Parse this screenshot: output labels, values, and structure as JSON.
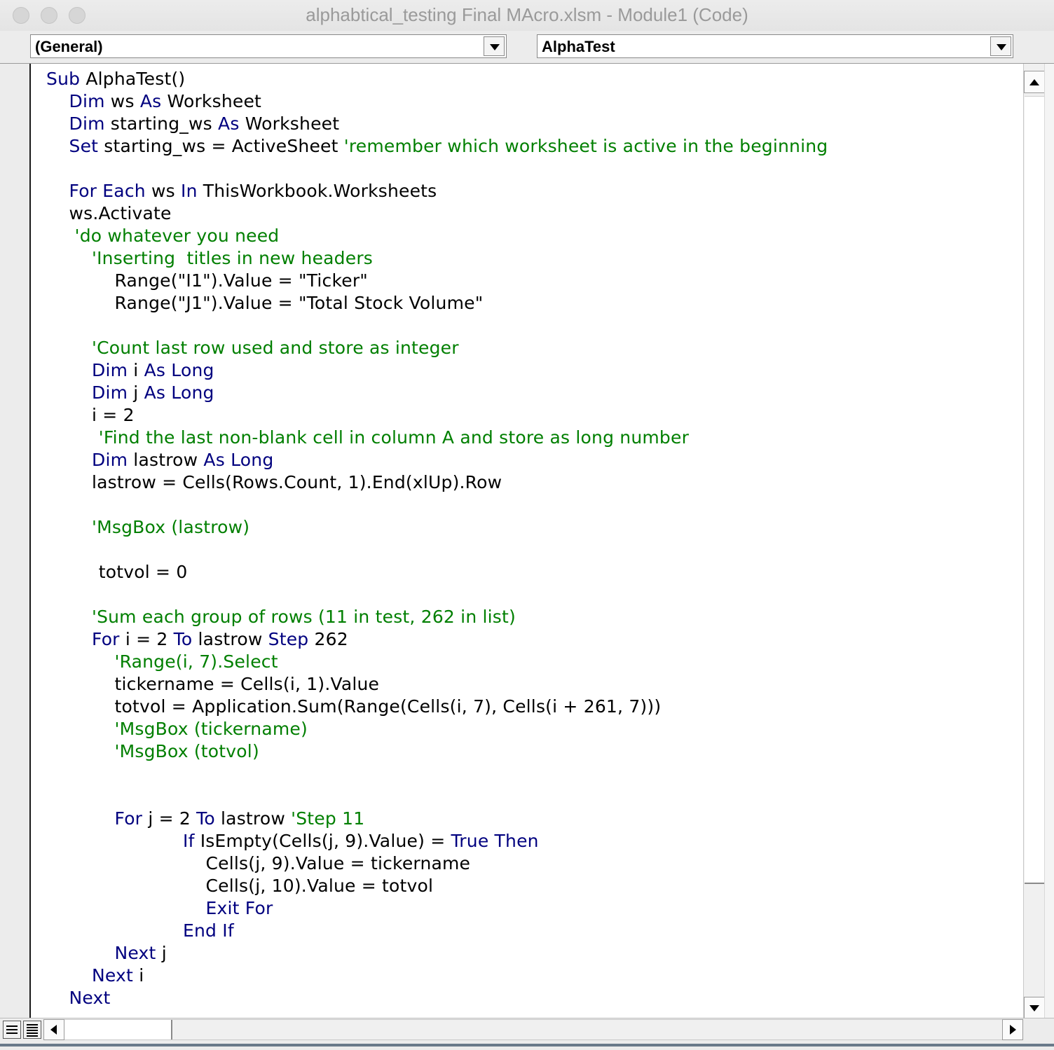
{
  "window": {
    "title": "alphabtical_testing Final MAcro.xlsm - Module1 (Code)"
  },
  "dropdowns": {
    "object": "(General)",
    "procedure": "AlphaTest"
  },
  "code_lines": [
    {
      "indent": 0,
      "tokens": [
        {
          "t": "Sub",
          "c": "kw"
        },
        {
          "t": " AlphaTest()",
          "c": ""
        }
      ]
    },
    {
      "indent": 1,
      "tokens": [
        {
          "t": "Dim",
          "c": "kw"
        },
        {
          "t": " ws ",
          "c": ""
        },
        {
          "t": "As",
          "c": "kw"
        },
        {
          "t": " Worksheet",
          "c": ""
        }
      ]
    },
    {
      "indent": 1,
      "tokens": [
        {
          "t": "Dim",
          "c": "kw"
        },
        {
          "t": " starting_ws ",
          "c": ""
        },
        {
          "t": "As",
          "c": "kw"
        },
        {
          "t": " Worksheet",
          "c": ""
        }
      ]
    },
    {
      "indent": 1,
      "tokens": [
        {
          "t": "Set",
          "c": "kw"
        },
        {
          "t": " starting_ws = ActiveSheet ",
          "c": ""
        },
        {
          "t": "'remember which worksheet is active in the beginning",
          "c": "cm"
        }
      ]
    },
    {
      "indent": 1,
      "tokens": []
    },
    {
      "indent": 1,
      "tokens": [
        {
          "t": "For Each",
          "c": "kw"
        },
        {
          "t": " ws ",
          "c": ""
        },
        {
          "t": "In",
          "c": "kw"
        },
        {
          "t": " ThisWorkbook.Worksheets",
          "c": ""
        }
      ]
    },
    {
      "indent": 1,
      "tokens": [
        {
          "t": "ws.Activate",
          "c": ""
        }
      ]
    },
    {
      "indent": 1.25,
      "tokens": [
        {
          "t": "'do whatever you need",
          "c": "cm"
        }
      ]
    },
    {
      "indent": 2,
      "tokens": [
        {
          "t": "'Inserting  titles in new headers",
          "c": "cm"
        }
      ]
    },
    {
      "indent": 3,
      "tokens": [
        {
          "t": "Range(\"I1\").Value = \"Ticker\"",
          "c": ""
        }
      ]
    },
    {
      "indent": 3,
      "tokens": [
        {
          "t": "Range(\"J1\").Value = \"Total Stock Volume\"",
          "c": ""
        }
      ]
    },
    {
      "indent": 2,
      "tokens": []
    },
    {
      "indent": 2,
      "tokens": [
        {
          "t": "'Count last row used and store as integer",
          "c": "cm"
        }
      ]
    },
    {
      "indent": 2,
      "tokens": [
        {
          "t": "Dim",
          "c": "kw"
        },
        {
          "t": " i ",
          "c": ""
        },
        {
          "t": "As Long",
          "c": "kw"
        }
      ]
    },
    {
      "indent": 2,
      "tokens": [
        {
          "t": "Dim",
          "c": "kw"
        },
        {
          "t": " j ",
          "c": ""
        },
        {
          "t": "As Long",
          "c": "kw"
        }
      ]
    },
    {
      "indent": 2,
      "tokens": [
        {
          "t": "i = 2",
          "c": ""
        }
      ]
    },
    {
      "indent": 2.3,
      "tokens": [
        {
          "t": "'Find the last non-blank cell in column A and store as long number",
          "c": "cm"
        }
      ]
    },
    {
      "indent": 2,
      "tokens": [
        {
          "t": "Dim",
          "c": "kw"
        },
        {
          "t": " lastrow ",
          "c": ""
        },
        {
          "t": "As Long",
          "c": "kw"
        }
      ]
    },
    {
      "indent": 2,
      "tokens": [
        {
          "t": "lastrow = Cells(Rows.Count, 1).End(xlUp).Row",
          "c": ""
        }
      ]
    },
    {
      "indent": 2,
      "tokens": []
    },
    {
      "indent": 2,
      "tokens": [
        {
          "t": "'MsgBox (lastrow)",
          "c": "cm"
        }
      ]
    },
    {
      "indent": 2,
      "tokens": []
    },
    {
      "indent": 2.3,
      "tokens": [
        {
          "t": "totvol = 0",
          "c": ""
        }
      ]
    },
    {
      "indent": 2,
      "tokens": []
    },
    {
      "indent": 2,
      "tokens": [
        {
          "t": "'Sum each group of rows (11 in test, 262 in list)",
          "c": "cm"
        }
      ]
    },
    {
      "indent": 2,
      "tokens": [
        {
          "t": "For",
          "c": "kw"
        },
        {
          "t": " i = 2 ",
          "c": ""
        },
        {
          "t": "To",
          "c": "kw"
        },
        {
          "t": " lastrow ",
          "c": ""
        },
        {
          "t": "Step",
          "c": "kw"
        },
        {
          "t": " 262",
          "c": ""
        }
      ]
    },
    {
      "indent": 3,
      "tokens": [
        {
          "t": "'Range(i, 7).Select",
          "c": "cm"
        }
      ]
    },
    {
      "indent": 3,
      "tokens": [
        {
          "t": "tickername = Cells(i, 1).Value",
          "c": ""
        }
      ]
    },
    {
      "indent": 3,
      "tokens": [
        {
          "t": "totvol = Application.Sum(Range(Cells(i, 7), Cells(i + 261, 7)))",
          "c": ""
        }
      ]
    },
    {
      "indent": 3,
      "tokens": [
        {
          "t": "'MsgBox (tickername)",
          "c": "cm"
        }
      ]
    },
    {
      "indent": 3,
      "tokens": [
        {
          "t": "'MsgBox (totvol)",
          "c": "cm"
        }
      ]
    },
    {
      "indent": 3,
      "tokens": []
    },
    {
      "indent": 3,
      "tokens": []
    },
    {
      "indent": 3,
      "tokens": [
        {
          "t": "For",
          "c": "kw"
        },
        {
          "t": " j = 2 ",
          "c": ""
        },
        {
          "t": "To",
          "c": "kw"
        },
        {
          "t": " lastrow ",
          "c": ""
        },
        {
          "t": "'Step 11",
          "c": "cm"
        }
      ]
    },
    {
      "indent": 6,
      "tokens": [
        {
          "t": "If",
          "c": "kw"
        },
        {
          "t": " IsEmpty(Cells(j, 9).Value) = ",
          "c": ""
        },
        {
          "t": "True Then",
          "c": "kw"
        }
      ]
    },
    {
      "indent": 7,
      "tokens": [
        {
          "t": "Cells(j, 9).Value = tickername",
          "c": ""
        }
      ]
    },
    {
      "indent": 7,
      "tokens": [
        {
          "t": "Cells(j, 10).Value = totvol",
          "c": ""
        }
      ]
    },
    {
      "indent": 7,
      "tokens": [
        {
          "t": "Exit For",
          "c": "kw"
        }
      ]
    },
    {
      "indent": 6,
      "tokens": [
        {
          "t": "End If",
          "c": "kw"
        }
      ]
    },
    {
      "indent": 3,
      "tokens": [
        {
          "t": "Next",
          "c": "kw"
        },
        {
          "t": " j",
          "c": ""
        }
      ]
    },
    {
      "indent": 2,
      "tokens": [
        {
          "t": "Next",
          "c": "kw"
        },
        {
          "t": " i",
          "c": ""
        }
      ]
    },
    {
      "indent": 1,
      "tokens": [
        {
          "t": "Next",
          "c": "kw"
        }
      ]
    }
  ],
  "colors": {
    "keyword": "#00007f",
    "comment": "#007f00",
    "text": "#000000"
  },
  "icons": {
    "procedure_view": "procedure-view-icon",
    "full_module_view": "full-module-view-icon"
  }
}
